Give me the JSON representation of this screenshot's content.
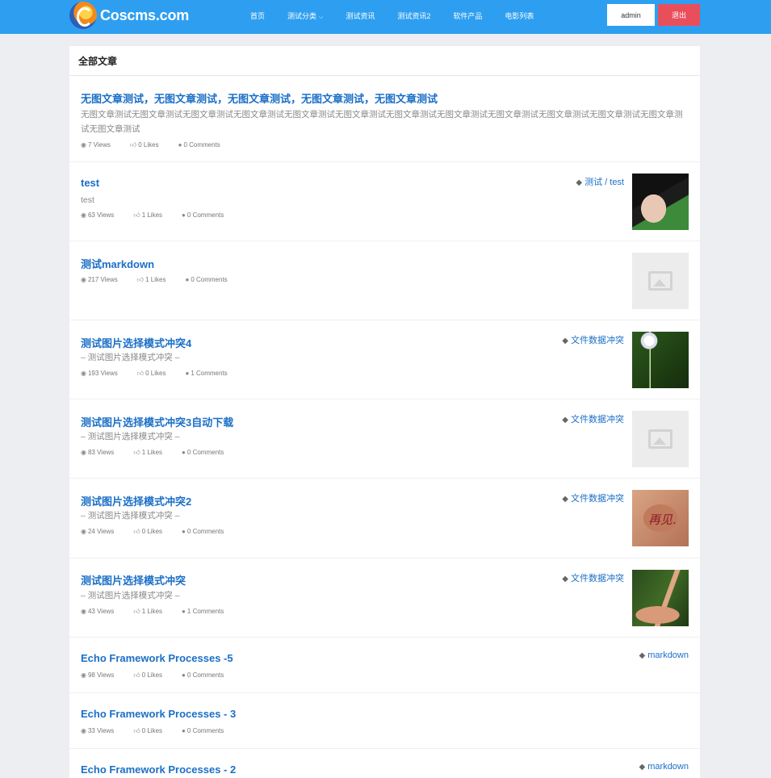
{
  "brand": {
    "name": "Coscms.com"
  },
  "nav": {
    "items": [
      {
        "label": "首页"
      },
      {
        "label": "测试分类",
        "caret": "⌵"
      },
      {
        "label": "测试资讯"
      },
      {
        "label": "测试资讯2"
      },
      {
        "label": "软件产品"
      },
      {
        "label": "电影列表"
      }
    ]
  },
  "user": {
    "name": "admin",
    "logout_label": "退出"
  },
  "section_title": "全部文章",
  "articles": [
    {
      "title": "无图文章测试，无图文章测试，无图文章测试，无图文章测试，无图文章测试",
      "desc": "无图文章测试无图文章测试无图文章测试无图文章测试无图文章测试无图文章测试无图文章测试无图文章测试无图文章测试无图文章测试无图文章测试无图文章测试无图文章测试",
      "views": "7 Views",
      "likes": "0 Likes",
      "comments": "0 Comments",
      "tag": "",
      "thumb": "none"
    },
    {
      "title": "test",
      "desc": "test",
      "views": "63 Views",
      "likes": "1 Likes",
      "comments": "0 Comments",
      "tag": "测试 / test",
      "thumb": "girl"
    },
    {
      "title": "测试markdown",
      "desc": "",
      "views": "217 Views",
      "likes": "1 Likes",
      "comments": "0 Comments",
      "tag": "",
      "thumb": "placeholder"
    },
    {
      "title": "测试图片选择模式冲突4",
      "desc": "– 测试图片选择模式冲突 –",
      "views": "193 Views",
      "likes": "0 Likes",
      "comments": "1 Comments",
      "tag": "文件数据冲突",
      "thumb": "dandelion"
    },
    {
      "title": "测试图片选择模式冲突3自动下载",
      "desc": "– 测试图片选择模式冲突 –",
      "views": "83 Views",
      "likes": "1 Likes",
      "comments": "0 Comments",
      "tag": "文件数据冲突",
      "thumb": "placeholder"
    },
    {
      "title": "测试图片选择模式冲突2",
      "desc": "– 测试图片选择模式冲突 –",
      "views": "24 Views",
      "likes": "0 Likes",
      "comments": "0 Comments",
      "tag": "文件数据冲突",
      "thumb": "skin",
      "thumb_text": "再见."
    },
    {
      "title": "测试图片选择模式冲突",
      "desc": "– 测试图片选择模式冲突 –",
      "views": "43 Views",
      "likes": "1 Likes",
      "comments": "1 Comments",
      "tag": "文件数据冲突",
      "thumb": "hand"
    },
    {
      "title": "Echo Framework Processes -5",
      "desc": "",
      "views": "98 Views",
      "likes": "0 Likes",
      "comments": "0 Comments",
      "tag": "markdown",
      "thumb": "none"
    },
    {
      "title": "Echo Framework Processes - 3",
      "desc": "",
      "views": "33 Views",
      "likes": "0 Likes",
      "comments": "0 Comments",
      "tag": "",
      "thumb": "none"
    },
    {
      "title": "Echo Framework Processes - 2",
      "desc": "",
      "views": "",
      "likes": "",
      "comments": "",
      "tag": "markdown",
      "thumb": "none"
    }
  ],
  "icons": {
    "views": "eye-icon",
    "likes": "thumbs-up-icon",
    "comments": "comment-icon",
    "tag": "tags-icon"
  },
  "colors": {
    "header": "#2e9ff0",
    "link": "#1b6fc7",
    "logout": "#e94f5b"
  }
}
